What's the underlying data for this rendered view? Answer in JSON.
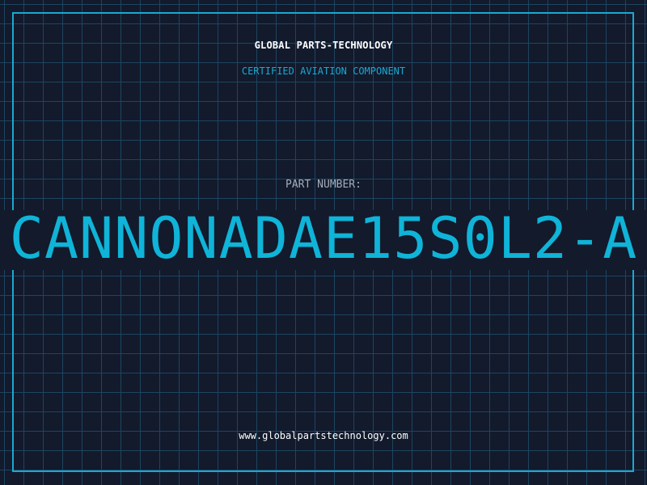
{
  "header": {
    "company_name": "GLOBAL PARTS-TECHNOLOGY",
    "subtitle": "CERTIFIED AVIATION COMPONENT"
  },
  "part": {
    "label": "PART NUMBER:",
    "number": "CANNONADAE15S0L2-A"
  },
  "footer": {
    "website": "www.globalpartstechnology.com"
  },
  "colors": {
    "background": "#121a2c",
    "grid": "#1d4560",
    "accent": "#1aa9d2",
    "part_number": "#0fb4d8",
    "text": "#ffffff",
    "label": "#a3adbb"
  }
}
